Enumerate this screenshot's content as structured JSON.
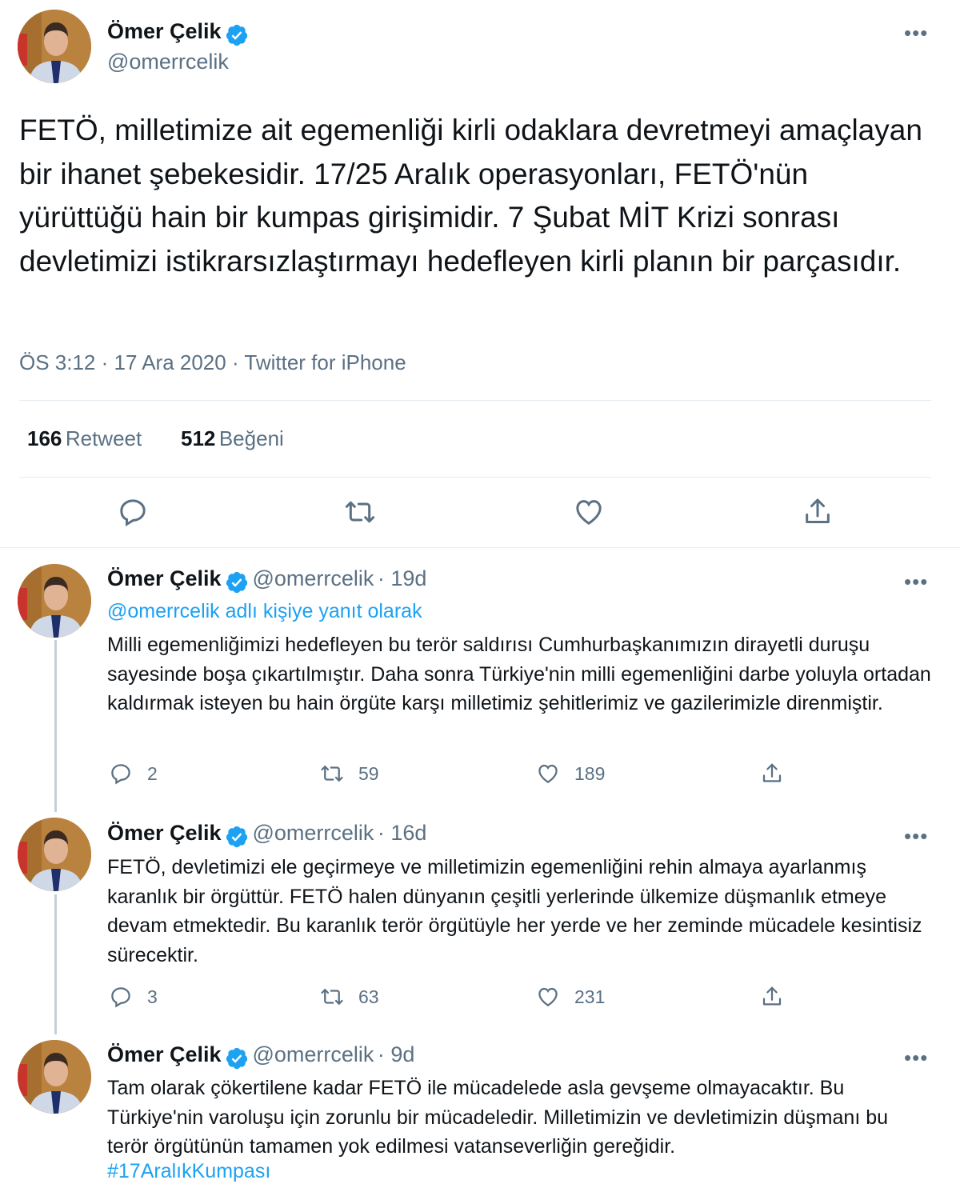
{
  "main_tweet": {
    "name": "Ömer Çelik",
    "handle": "@omerrcelik",
    "text": "FETÖ, milletimize ait egemenliği kirli odaklara devretmeyi amaçlayan bir ihanet şebekesidir. 17/25 Aralık operasyonları, FETÖ'nün yürüttüğü hain bir kumpas girişimidir. 7 Şubat MİT Krizi sonrası devletimizi istikrarsızlaştırmayı hedefleyen kirli planın bir parçasıdır.",
    "meta": "ÖS 3:12 · 17 Ara 2020 · Twitter for iPhone",
    "retweet_count": "166",
    "retweet_label": "Retweet",
    "like_count": "512",
    "like_label": "Beğeni"
  },
  "replies": [
    {
      "name": "Ömer Çelik",
      "handle": "@omerrcelik",
      "time": "· 19d",
      "reply_to": "@omerrcelik adlı kişiye yanıt olarak",
      "text": "Milli egemenliğimizi hedefleyen bu terör saldırısı Cumhurbaşkanımızın dirayetli duruşu sayesinde boşa çıkartılmıştır. Daha sonra Türkiye'nin milli egemenliğini darbe yoluyla ortadan kaldırmak isteyen bu hain örgüte karşı milletimiz şehitlerimiz ve gazilerimizle direnmiştir.",
      "replies": "2",
      "retweets": "59",
      "likes": "189"
    },
    {
      "name": "Ömer Çelik",
      "handle": "@omerrcelik",
      "time": "· 16d",
      "text": "FETÖ, devletimizi ele geçirmeye ve milletimizin egemenliğini rehin almaya ayarlanmış karanlık bir örgüttür. FETÖ halen dünyanın çeşitli yerlerinde ülkemize düşmanlık etmeye devam etmektedir. Bu karanlık terör örgütüyle her yerde ve her zeminde mücadele kesintisiz sürecektir.",
      "replies": "3",
      "retweets": "63",
      "likes": "231"
    },
    {
      "name": "Ömer Çelik",
      "handle": "@omerrcelik",
      "time": "· 9d",
      "text": "Tam olarak çökertilene kadar FETÖ ile mücadelede asla gevşeme olmayacaktır. Bu Türkiye'nin varoluşu için zorunlu bir mücadeledir. Milletimizin ve devletimizin düşmanı bu terör örgütünün tamamen yok edilmesi vatanseverliğin gereğidir.",
      "hashtag": "#17AralıkKumpası"
    }
  ],
  "colors": {
    "accent": "#1da1f2",
    "muted": "#5b7083",
    "text": "#0f1419"
  },
  "icons": [
    "verified-badge-icon",
    "more-icon",
    "reply-icon",
    "retweet-icon",
    "like-icon",
    "share-icon"
  ]
}
